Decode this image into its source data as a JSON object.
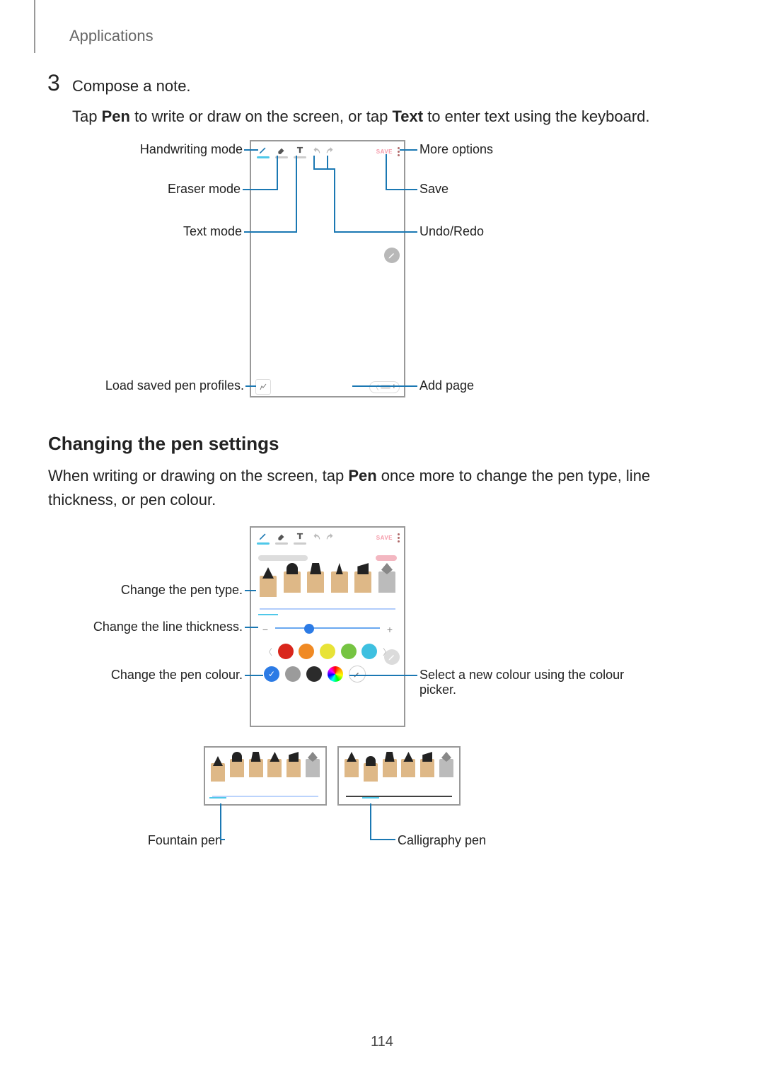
{
  "section": "Applications",
  "step": {
    "number": "3",
    "title": "Compose a note."
  },
  "step_body": {
    "prefix": "Tap ",
    "b1": "Pen",
    "mid": " to write or draw on the screen, or tap ",
    "b2": "Text",
    "suffix": " to enter text using the keyboard."
  },
  "dia1_labels": {
    "handwriting": "Handwriting mode",
    "eraser": "Eraser mode",
    "text": "Text mode",
    "profiles": "Load saved pen profiles.",
    "more": "More options",
    "save": "Save",
    "undoredo": "Undo/Redo",
    "addpage": "Add page"
  },
  "toolbar": {
    "save": "SAVE"
  },
  "h2": "Changing the pen settings",
  "body2": {
    "prefix": "When writing or drawing on the screen, tap ",
    "b1": "Pen",
    "suffix": " once more to change the pen type, line thickness, or pen colour."
  },
  "dia2_labels": {
    "pentype": "Change the pen type.",
    "linethick": "Change the line thickness.",
    "pencolour": "Change the pen colour.",
    "picker": "Select a new colour using the colour picker."
  },
  "colors_top": [
    "#d9261c",
    "#f08a24",
    "#e8e337",
    "#76c442",
    "#3ec0e0"
  ],
  "colors_bottom_grey": [
    "#9b9b9b",
    "#2b2b2b"
  ],
  "thumb_labels": {
    "fountain": "Fountain pen",
    "calligraphy": "Calligraphy pen"
  },
  "page_number": "114"
}
